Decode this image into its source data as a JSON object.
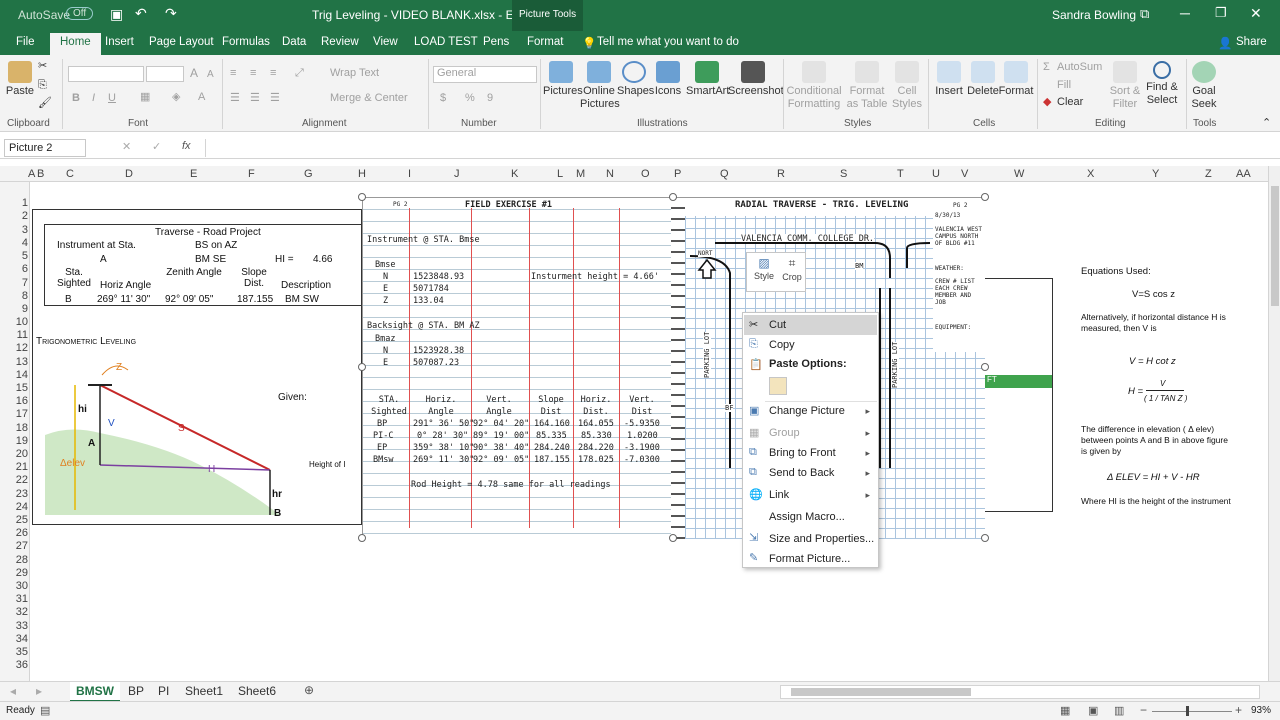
{
  "title_bar": {
    "autosave_label": "AutoSave",
    "autosave_state": "Off",
    "file_title": "Trig Leveling - VIDEO BLANK.xlsx - Excel",
    "context_tab": "Picture Tools",
    "user": "Sandra Bowling",
    "share": "Share"
  },
  "tabs": [
    "File",
    "Home",
    "Insert",
    "Page Layout",
    "Formulas",
    "Data",
    "Review",
    "View",
    "LOAD TEST",
    "Pens",
    "Format"
  ],
  "tell_me": "Tell me what you want to do",
  "ribbon": {
    "paste": "Paste",
    "font_size_up": "A",
    "font_size_down": "A",
    "bold": "B",
    "italic": "I",
    "underline": "U",
    "wrap_text": "Wrap Text",
    "merge_center": "Merge & Center",
    "number_format": "General",
    "percent": "%",
    "comma": "9",
    "pictures": "Pictures",
    "online_pictures": "Online Pictures",
    "shapes": "Shapes",
    "icons": "Icons",
    "smartart": "SmartArt",
    "screenshot": "Screenshot",
    "conditional_formatting": "Conditional Formatting",
    "format_as_table": "Format as Table",
    "cell_styles": "Cell Styles",
    "insert": "Insert",
    "delete": "Delete",
    "format": "Format",
    "autosum": "AutoSum",
    "fill": "Fill",
    "clear": "Clear",
    "sort_filter": "Sort & Filter",
    "find_select": "Find & Select",
    "goal_seek": "Goal Seek",
    "groups": {
      "clipboard": "Clipboard",
      "font": "Font",
      "alignment": "Alignment",
      "number": "Number",
      "illustrations": "Illustrations",
      "styles": "Styles",
      "cells": "Cells",
      "editing": "Editing",
      "tools": "Tools"
    }
  },
  "name_box": "Picture 2",
  "fx": "fx",
  "columns": [
    "A",
    "B",
    "C",
    "D",
    "E",
    "F",
    "G",
    "H",
    "I",
    "J",
    "K",
    "L",
    "M",
    "N",
    "O",
    "P",
    "Q",
    "R",
    "S",
    "T",
    "U",
    "V",
    "W",
    "X",
    "Y",
    "Z",
    "AA"
  ],
  "rows": [
    "1",
    "2",
    "3",
    "4",
    "5",
    "6",
    "7",
    "8",
    "9",
    "10",
    "11",
    "12",
    "13",
    "14",
    "15",
    "16",
    "17",
    "18",
    "19",
    "20",
    "21",
    "22",
    "23",
    "24",
    "25",
    "26",
    "27",
    "28",
    "29",
    "30",
    "31",
    "32",
    "33",
    "34",
    "35",
    "36"
  ],
  "sheet_table": {
    "title": "Traverse - Road Project",
    "instrument_at_sta": "Instrument at Sta.",
    "instrument_val": "A",
    "bs_on_az": "BS on AZ",
    "bs_val": "BM SE",
    "hi_label": "HI =",
    "hi_val": "4.66",
    "headers": [
      "Sta. Sighted",
      "Horiz Angle",
      "Zenith Angle",
      "Slope Dist.",
      "Description"
    ],
    "row": [
      "B",
      "269° 11' 30\"",
      "92° 09' 05\"",
      "187.155",
      "BM SW"
    ]
  },
  "trig_title": "Trigonometric Leveling",
  "given": "Given:",
  "height_text": "Height of I",
  "diagram_labels": [
    "Z",
    "hi",
    "A",
    "V",
    "S",
    "Δelev",
    "H",
    "hr",
    "B"
  ],
  "field_exercise": {
    "pg": "PG 2",
    "title": "FIELD EXERCISE #1",
    "instrument": "Instrument @ STA. Bmse",
    "bmse": "Bmse",
    "n_label": "N",
    "n_val": "1523848.93",
    "e_label": "E",
    "e_val": "5071784",
    "z_label": "Z",
    "z_val": "133.04",
    "inst_height": "Insturment height = 4.66'",
    "backsight": "Backsight @ STA. BM AZ",
    "bmaz": "Bmaz",
    "bn_val": "1523928.38",
    "be_val": "507087.23",
    "headers": [
      "STA. Sighted",
      "Horiz. Angle",
      "Vert. Angle",
      "Slope Dist",
      "Horiz. Dist.",
      "Vert. Dist"
    ],
    "rows": [
      [
        "BP",
        "291° 36' 50\"",
        "92° 04' 20\"",
        "164.160",
        "164.055",
        "-5.9350"
      ],
      [
        "PI-C",
        "0° 28' 30\"",
        "89° 19' 00\"",
        "85.335",
        "85.330",
        "1.0200"
      ],
      [
        "EP",
        "359° 38' 10\"",
        "90° 38' 40\"",
        "284.240",
        "284.220",
        "-3.1900"
      ],
      [
        "BMsw",
        "269° 11' 30\"",
        "92° 09' 05\"",
        "187.155",
        "178.025",
        "-7.0300"
      ]
    ],
    "rod_height": "Rod Height = 4.78 same for all readings"
  },
  "radial": {
    "title": "RADIAL TRAVERSE - TRIG. LEVELING",
    "pg": "PG 2",
    "date": "8/30/13",
    "college": "VALENCIA COMM. COLLEGE DR.",
    "location": "VALENCIA WEST CAMPUS NORTH OF BLDG #11",
    "weather": "WEATHER:",
    "crew": "CREW # LIST EACH CREW MEMBER AND JOB",
    "equipment": "EQUIPMENT:",
    "north": "NORT",
    "parking": "PARKING LOT",
    "bm": "BM",
    "bf": "BF",
    "ft": "FT"
  },
  "equations": {
    "used": "Equations Used:",
    "v": "V=S cos z",
    "alt": "Alternatively, if horizontal distance H is measured, then V is",
    "v2": "V = H cot z",
    "h": "H =",
    "h_num": "V",
    "h_den": "( 1 / TAN Z )",
    "diff": "The difference in elevation ( Δ elev) between points A and B in above figure is given by",
    "delev": "Δ ELEV = HI + V - HR",
    "where": "Where HI is the height of the instrument"
  },
  "mini_toolbar": {
    "style": "Style",
    "crop": "Crop"
  },
  "context_menu": {
    "cut": "Cut",
    "copy": "Copy",
    "paste_options": "Paste Options:",
    "change_picture": "Change Picture",
    "group": "Group",
    "bring_to_front": "Bring to Front",
    "send_to_back": "Send to Back",
    "link": "Link",
    "assign_macro": "Assign Macro...",
    "size_properties": "Size and Properties...",
    "format_picture": "Format Picture..."
  },
  "sheet_tabs": [
    "BMSW",
    "BP",
    "PI",
    "Sheet1",
    "Sheet6"
  ],
  "active_sheet": "BMSW",
  "status": {
    "ready": "Ready",
    "zoom": "93%"
  },
  "colors": {
    "excel_green": "#217346",
    "highlight": "#3fa34d"
  }
}
